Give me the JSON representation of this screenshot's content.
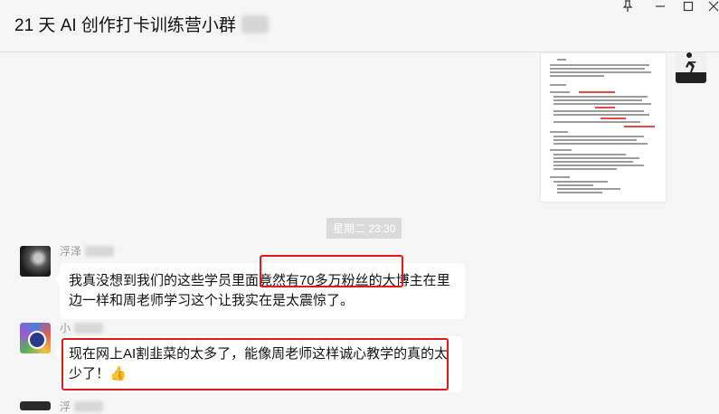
{
  "window": {
    "title": "21 天 AI 创作打卡训练营小群",
    "controls": [
      "pin-icon",
      "minimize-icon",
      "maximize-icon",
      "close-icon"
    ]
  },
  "chat": {
    "timestamp": "星期二 23:30",
    "messages": [
      {
        "sender": "浮泽",
        "text": "我真没想到我们的这些学员里面竟然有70多万粉丝的大博主在里边一样和周老师学习这个让我实在是太震惊了。",
        "highlight": "然有70多万粉丝的大博主"
      },
      {
        "sender": "小",
        "text": "现在网上AI割韭菜的太多了，能像周老师这样诚心教学的真的太少了！",
        "emoji": "👍"
      },
      {
        "sender": "浮"
      }
    ]
  },
  "colors": {
    "background": "#f5f5f5",
    "bubble": "#ffffff",
    "highlight_red": "#e01818",
    "timestamp_bg": "#dadada"
  }
}
